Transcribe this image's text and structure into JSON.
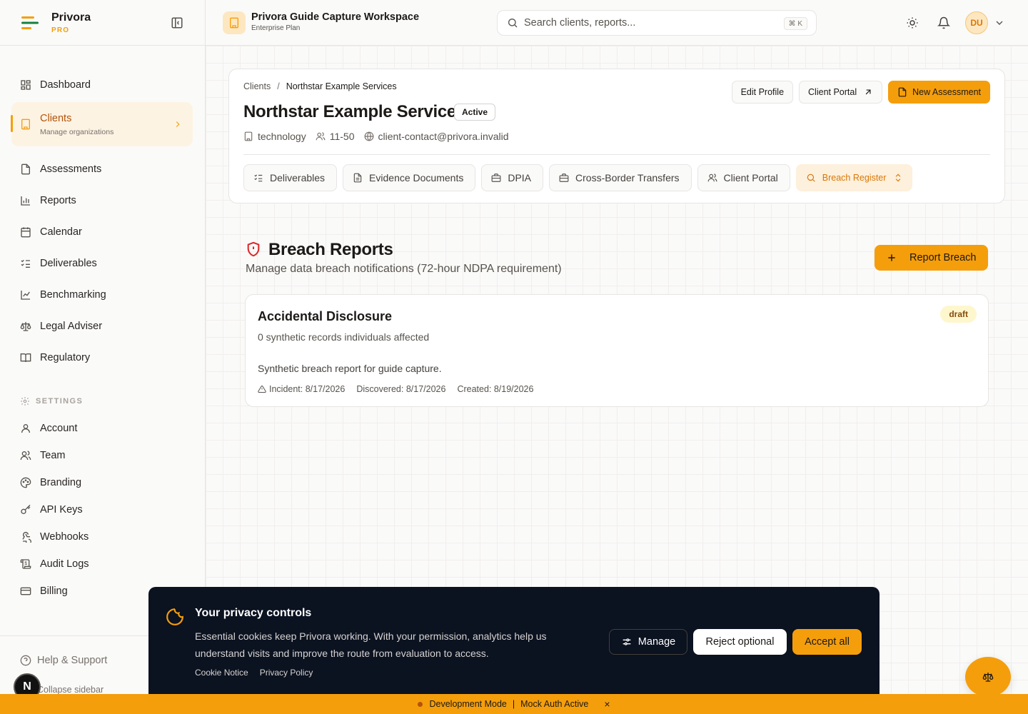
{
  "brand": {
    "name": "Privora",
    "tier": "PRO"
  },
  "topbar": {
    "workspace_title": "Privora Guide Capture Workspace",
    "workspace_plan": "Enterprise Plan",
    "search_placeholder": "Search clients, reports...",
    "search_shortcut": "⌘ K",
    "avatar_initials": "DU"
  },
  "sidebar": {
    "items": [
      {
        "label": "Dashboard",
        "icon": "dashboard-icon"
      },
      {
        "label": "Clients",
        "sub": "Manage organizations",
        "icon": "building-icon",
        "active": true
      },
      {
        "label": "Assessments",
        "icon": "file-icon"
      },
      {
        "label": "Reports",
        "icon": "bar-chart-icon"
      },
      {
        "label": "Calendar",
        "icon": "calendar-icon"
      },
      {
        "label": "Deliverables",
        "icon": "list-checks-icon"
      },
      {
        "label": "Benchmarking",
        "icon": "line-chart-icon"
      },
      {
        "label": "Legal Adviser",
        "icon": "scale-icon"
      },
      {
        "label": "Regulatory",
        "icon": "book-icon"
      }
    ],
    "settings_heading": "SETTINGS",
    "settings_items": [
      {
        "label": "Account",
        "icon": "user-icon"
      },
      {
        "label": "Team",
        "icon": "users-icon"
      },
      {
        "label": "Branding",
        "icon": "palette-icon"
      },
      {
        "label": "API Keys",
        "icon": "key-icon"
      },
      {
        "label": "Webhooks",
        "icon": "webhook-icon"
      },
      {
        "label": "Audit Logs",
        "icon": "scroll-icon"
      },
      {
        "label": "Billing",
        "icon": "credit-card-icon"
      }
    ],
    "help_label": "Help & Support",
    "collapse_label": "Collapse sidebar",
    "badge_letter": "N"
  },
  "client": {
    "breadcrumb_root": "Clients",
    "breadcrumb_sep": "/",
    "breadcrumb_current": "Northstar Example Services",
    "name": "Northstar Example Services",
    "status": "Active",
    "industry": "technology",
    "size": "11-50",
    "email": "client-contact@privora.invalid",
    "actions": {
      "edit": "Edit Profile",
      "portal": "Client Portal",
      "new_assessment": "New Assessment"
    },
    "tabs": [
      {
        "label": "Deliverables",
        "icon": "list-checks-icon"
      },
      {
        "label": "Evidence Documents",
        "icon": "file-text-icon"
      },
      {
        "label": "DPIA",
        "icon": "briefcase-icon"
      },
      {
        "label": "Cross-Border Transfers",
        "icon": "briefcase-icon"
      },
      {
        "label": "Client Portal",
        "icon": "users-icon"
      },
      {
        "label": "Breach Register",
        "icon": "search-icon",
        "active": true
      }
    ]
  },
  "breach": {
    "title": "Breach Reports",
    "subtitle": "Manage data breach notifications (72-hour NDPA requirement)",
    "report_button": "Report Breach",
    "card": {
      "title": "Accidental Disclosure",
      "affected": "0 synthetic records individuals affected",
      "description": "Synthetic breach report for guide capture.",
      "incident": "Incident: 8/17/2026",
      "discovered": "Discovered: 8/17/2026",
      "created": "Created: 8/19/2026",
      "status": "draft"
    }
  },
  "cookie": {
    "title": "Your privacy controls",
    "text": "Essential cookies keep Privora working. With your permission, analytics help us understand visits and improve the route from evaluation to access.",
    "link_notice": "Cookie Notice",
    "link_privacy": "Privacy Policy",
    "manage": "Manage",
    "reject": "Reject optional",
    "accept": "Accept all"
  },
  "dev_bar": {
    "mode": "Development Mode",
    "sep": "|",
    "auth": "Mock Auth Active",
    "close": "×"
  },
  "colors": {
    "accent": "#f59e0b",
    "danger": "#dc2626",
    "banner": "#0b1220"
  }
}
